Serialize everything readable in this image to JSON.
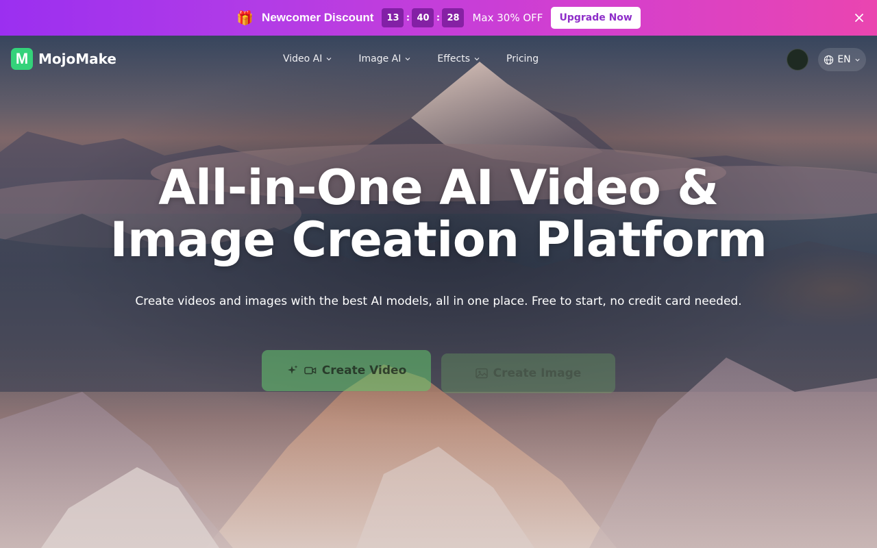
{
  "promo": {
    "gift_icon": "gift-icon",
    "title": "Newcomer Discount",
    "countdown": [
      "13",
      "40",
      "28"
    ],
    "separator": ":",
    "offer": "Max 30% OFF",
    "cta": "Upgrade Now",
    "close_icon": "close-icon",
    "colors": {
      "gradient_start": "#9b2ff0",
      "gradient_end": "#ea45b0",
      "cta_text": "#8e2ec9"
    }
  },
  "nav": {
    "logo_letter": "M",
    "brand": "MojoMake",
    "brand_color": "#34d27a",
    "menu": [
      {
        "label": "Video AI",
        "has_dropdown": true
      },
      {
        "label": "Image AI",
        "has_dropdown": true
      },
      {
        "label": "Effects",
        "has_dropdown": true
      },
      {
        "label": "Pricing",
        "has_dropdown": false
      }
    ],
    "language": "EN",
    "language_icon": "globe-icon"
  },
  "hero": {
    "headline_line1": "All-in-One AI Video &",
    "headline_line2": "Image Creation Platform",
    "subtitle": "Create videos and images with the best AI models, all in one place. Free to start, no credit card needed.",
    "primary_cta": "Create Video",
    "primary_cta_icons": [
      "sparkle-icon",
      "video-camera-icon"
    ],
    "secondary_cta": "Create Image",
    "secondary_cta_icon": "image-icon"
  }
}
